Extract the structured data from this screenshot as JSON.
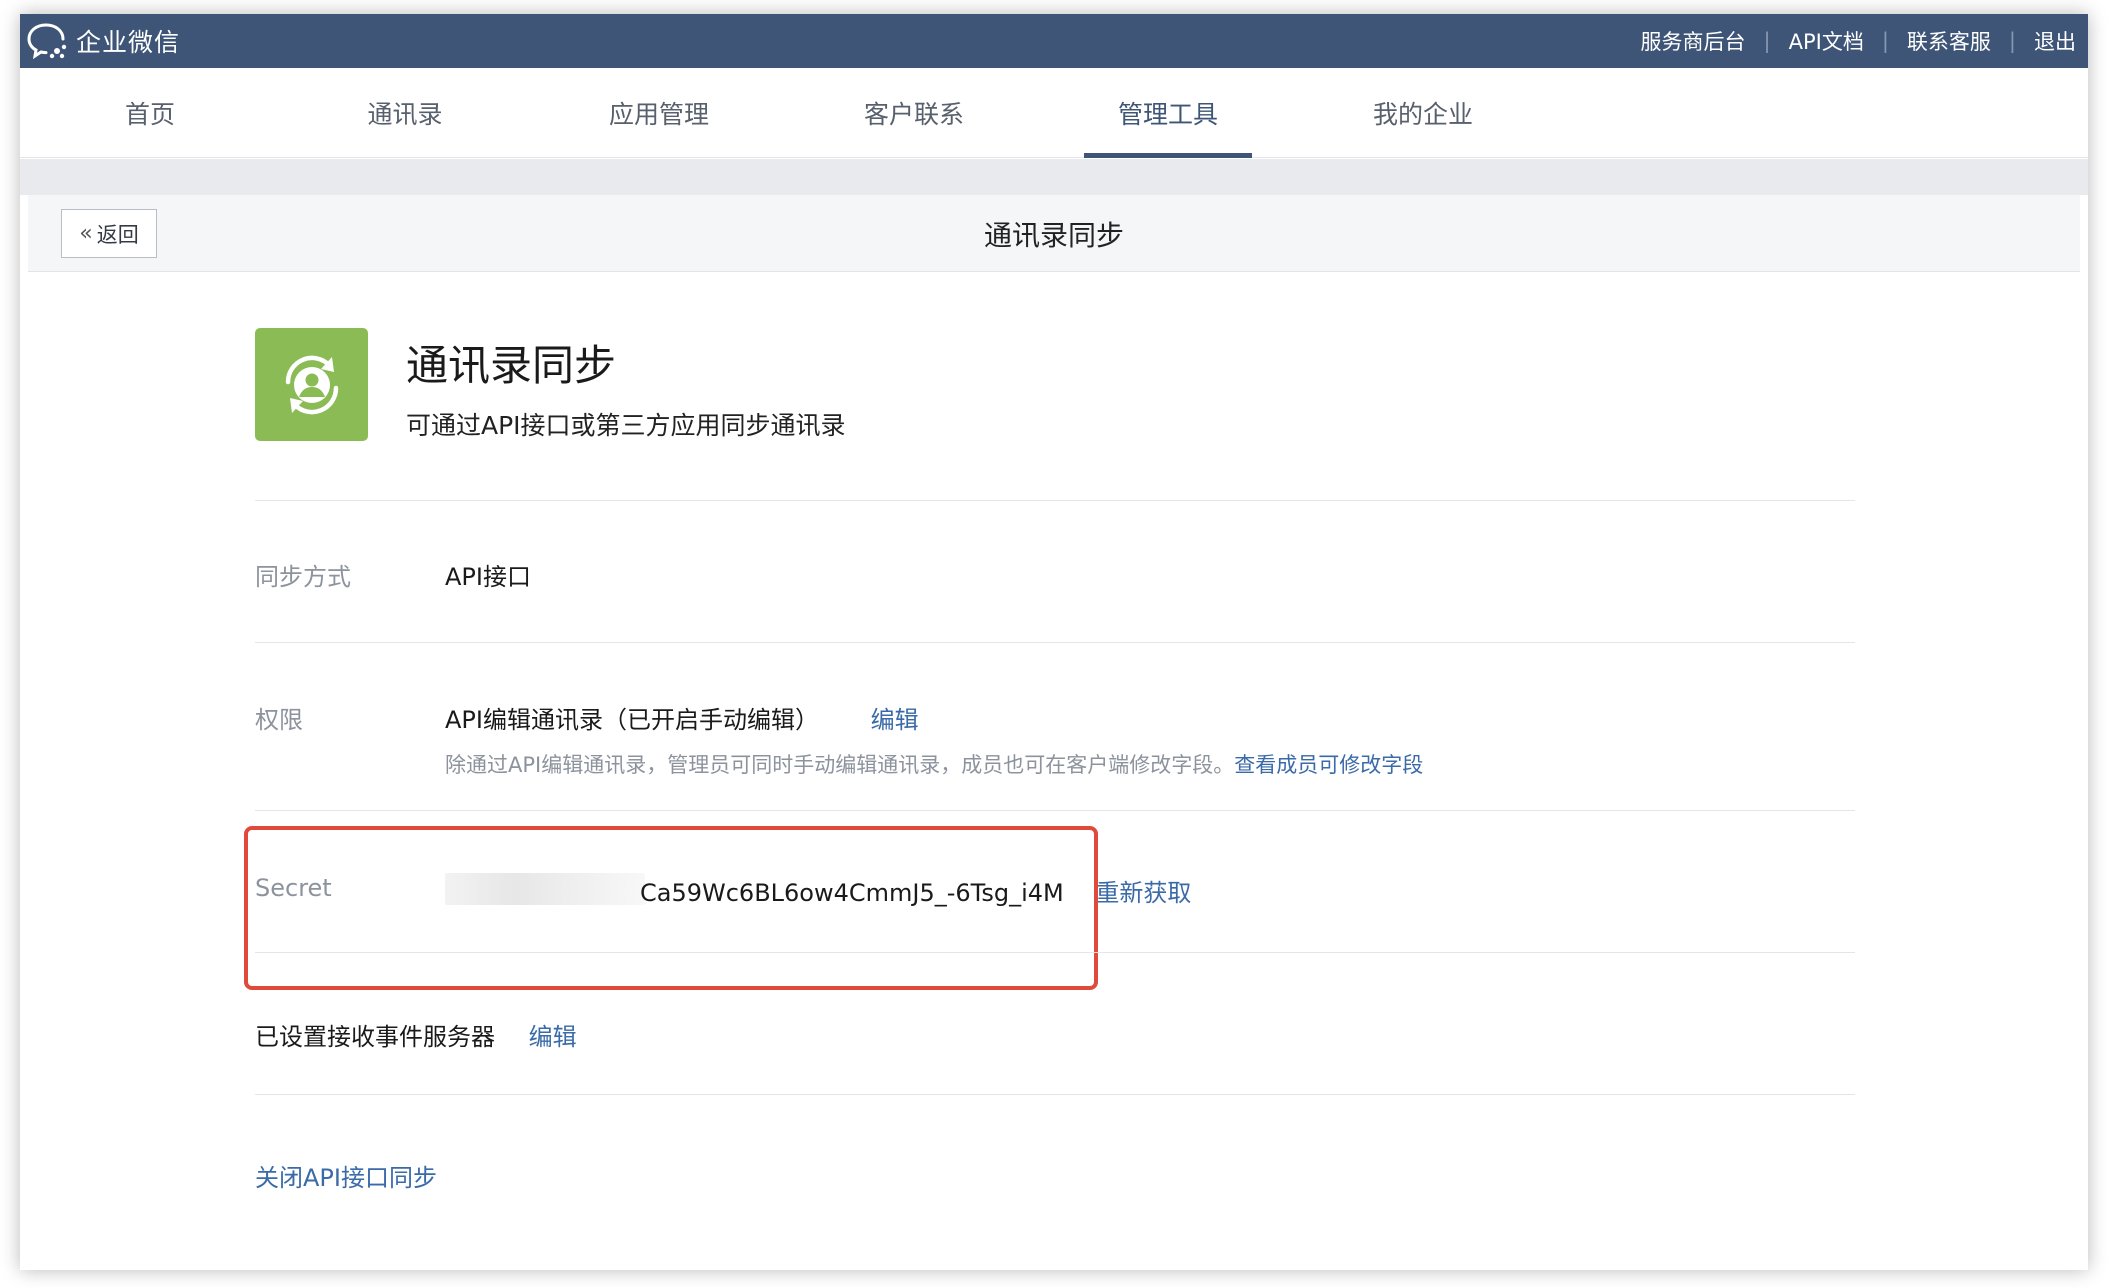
{
  "topbar": {
    "brand": "企业微信",
    "links": [
      "服务商后台",
      "API文档",
      "联系客服",
      "退出"
    ],
    "background_color": "#3e5577"
  },
  "nav": {
    "tabs": [
      "首页",
      "通讯录",
      "应用管理",
      "客户联系",
      "管理工具",
      "我的企业"
    ],
    "active_tab": "管理工具"
  },
  "header": {
    "back_label": "返回",
    "title": "通讯录同步"
  },
  "app": {
    "icon": "contacts-sync-icon",
    "icon_color": "#8bbb55",
    "title": "通讯录同步",
    "description": "可通过API接口或第三方应用同步通讯录"
  },
  "sync_mode": {
    "label": "同步方式",
    "value": "API接口"
  },
  "permission": {
    "label": "权限",
    "value": "API编辑通讯录（已开启手动编辑）",
    "edit_link": "编辑",
    "note": "除通过API编辑通讯录，管理员可同时手动编辑通讯录，成员也可在客户端修改字段。",
    "note_link": "查看成员可修改字段"
  },
  "secret": {
    "label": "Secret",
    "visible_value": "Ca59Wc6BL6ow4CmmJ5_-6Tsg_i4M",
    "refresh_link": "重新获取",
    "highlight_color": "#e04a3a"
  },
  "event_server": {
    "text": "已设置接收事件服务器",
    "edit_link": "编辑"
  },
  "close_sync_link": "关闭API接口同步",
  "link_color": "#3a6aa8"
}
